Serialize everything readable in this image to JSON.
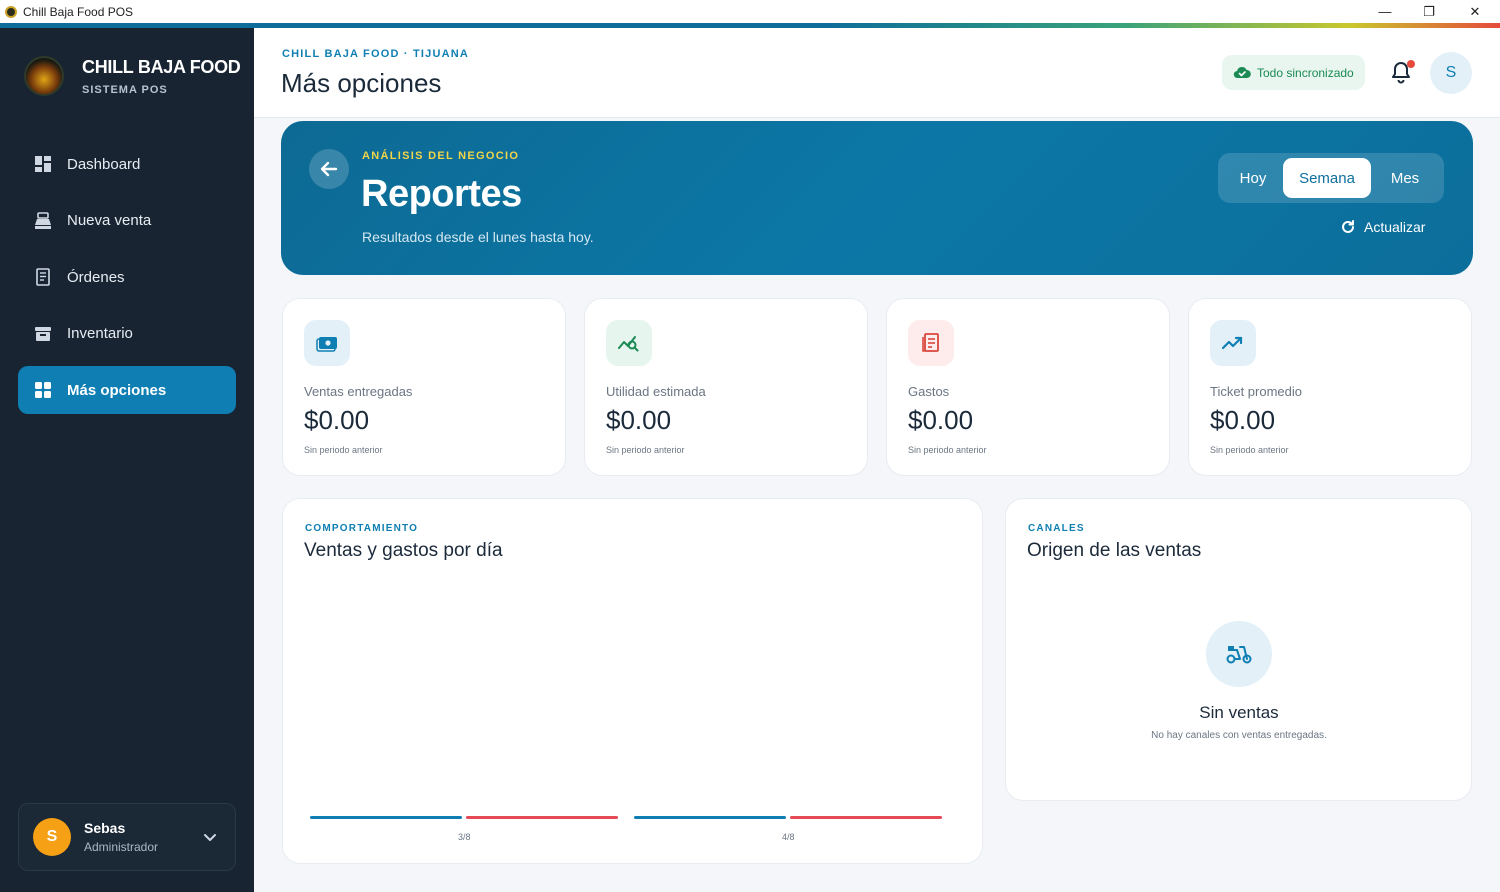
{
  "window": {
    "title": "Chill Baja Food POS",
    "minimize": "—",
    "maximize": "❐",
    "close": "✕"
  },
  "brand": {
    "name": "CHILL BAJA FOOD",
    "subtitle": "SISTEMA POS"
  },
  "sidebar": {
    "items": [
      {
        "label": "Dashboard",
        "icon": "dashboard-icon"
      },
      {
        "label": "Nueva venta",
        "icon": "cash-register-icon"
      },
      {
        "label": "Órdenes",
        "icon": "receipt-icon"
      },
      {
        "label": "Inventario",
        "icon": "archive-box-icon"
      },
      {
        "label": "Más opciones",
        "icon": "grid-icon",
        "active": true
      }
    ]
  },
  "user": {
    "initial": "S",
    "name": "Sebas",
    "role": "Administrador"
  },
  "header": {
    "breadcrumb": "CHILL BAJA FOOD · TIJUANA",
    "title": "Más opciones",
    "sync_status": "Todo sincronizado",
    "avatar_initial": "S"
  },
  "hero": {
    "kicker": "ANÁLISIS DEL NEGOCIO",
    "title": "Reportes",
    "subtitle": "Resultados desde el lunes hasta hoy.",
    "periods": [
      "Hoy",
      "Semana",
      "Mes"
    ],
    "selected_period": "Semana",
    "refresh_label": "Actualizar"
  },
  "kpis": [
    {
      "label": "Ventas entregadas",
      "value": "$0.00",
      "note": "Sin periodo anterior",
      "icon": "cash-icon",
      "color": "#0f7fb3",
      "bg": "#e3f0f8"
    },
    {
      "label": "Utilidad estimada",
      "value": "$0.00",
      "note": "Sin periodo anterior",
      "icon": "chart-search-icon",
      "color": "#1c8a55",
      "bg": "#e6f5ee"
    },
    {
      "label": "Gastos",
      "value": "$0.00",
      "note": "Sin periodo anterior",
      "icon": "bill-icon",
      "color": "#d9463b",
      "bg": "#fdeceb"
    },
    {
      "label": "Ticket promedio",
      "value": "$0.00",
      "note": "Sin periodo anterior",
      "icon": "trending-up-icon",
      "color": "#0f7fb3",
      "bg": "#e3f0f8"
    }
  ],
  "sales_chart": {
    "kicker": "COMPORTAMIENTO",
    "title": "Ventas y gastos por día"
  },
  "chart_data": {
    "type": "bar",
    "title": "Ventas y gastos por día",
    "categories": [
      "3/8",
      "4/8"
    ],
    "series": [
      {
        "values": [
          0,
          0
        ],
        "color": "#0f7fb3"
      },
      {
        "values": [
          0,
          0
        ],
        "color": "#e64a54"
      }
    ]
  },
  "channels": {
    "kicker": "CANALES",
    "title": "Origen de las ventas",
    "empty_title": "Sin ventas",
    "empty_subtitle": "No hay canales con ventas entregadas.",
    "empty_icon": "scooter-icon"
  },
  "colors": {
    "primary": "#0f7fb3",
    "sidebar": "#182432",
    "success": "#1c8a55",
    "danger": "#e64a3b",
    "kicker": "#f2d447"
  }
}
